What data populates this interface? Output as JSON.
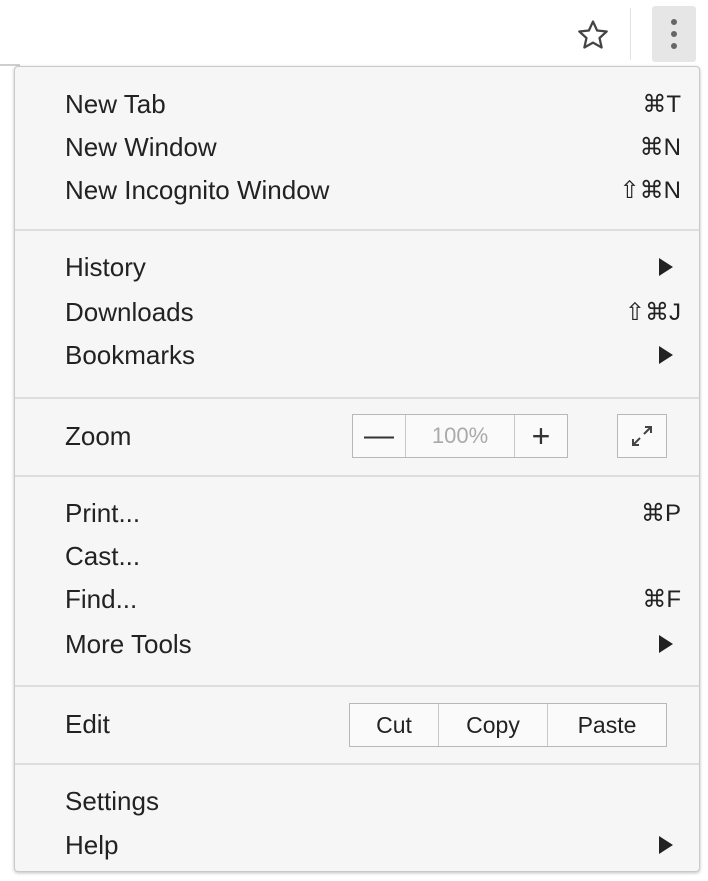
{
  "toolbar": {
    "star_icon": "star-outline-icon",
    "menu_icon": "vertical-dots-icon"
  },
  "menu": {
    "new_tab": {
      "label": "New Tab",
      "shortcut": "⌘T"
    },
    "new_window": {
      "label": "New Window",
      "shortcut": "⌘N"
    },
    "new_incognito": {
      "label": "New Incognito Window",
      "shortcut": "⇧⌘N"
    },
    "history": {
      "label": "History"
    },
    "downloads": {
      "label": "Downloads",
      "shortcut": "⇧⌘J"
    },
    "bookmarks": {
      "label": "Bookmarks"
    },
    "zoom": {
      "label": "Zoom",
      "minus": "—",
      "value": "100%",
      "plus": "+"
    },
    "print": {
      "label": "Print...",
      "shortcut": "⌘P"
    },
    "cast": {
      "label": "Cast..."
    },
    "find": {
      "label": "Find...",
      "shortcut": "⌘F"
    },
    "more_tools": {
      "label": "More Tools"
    },
    "edit": {
      "label": "Edit",
      "cut": "Cut",
      "copy": "Copy",
      "paste": "Paste"
    },
    "settings": {
      "label": "Settings"
    },
    "help": {
      "label": "Help"
    }
  }
}
